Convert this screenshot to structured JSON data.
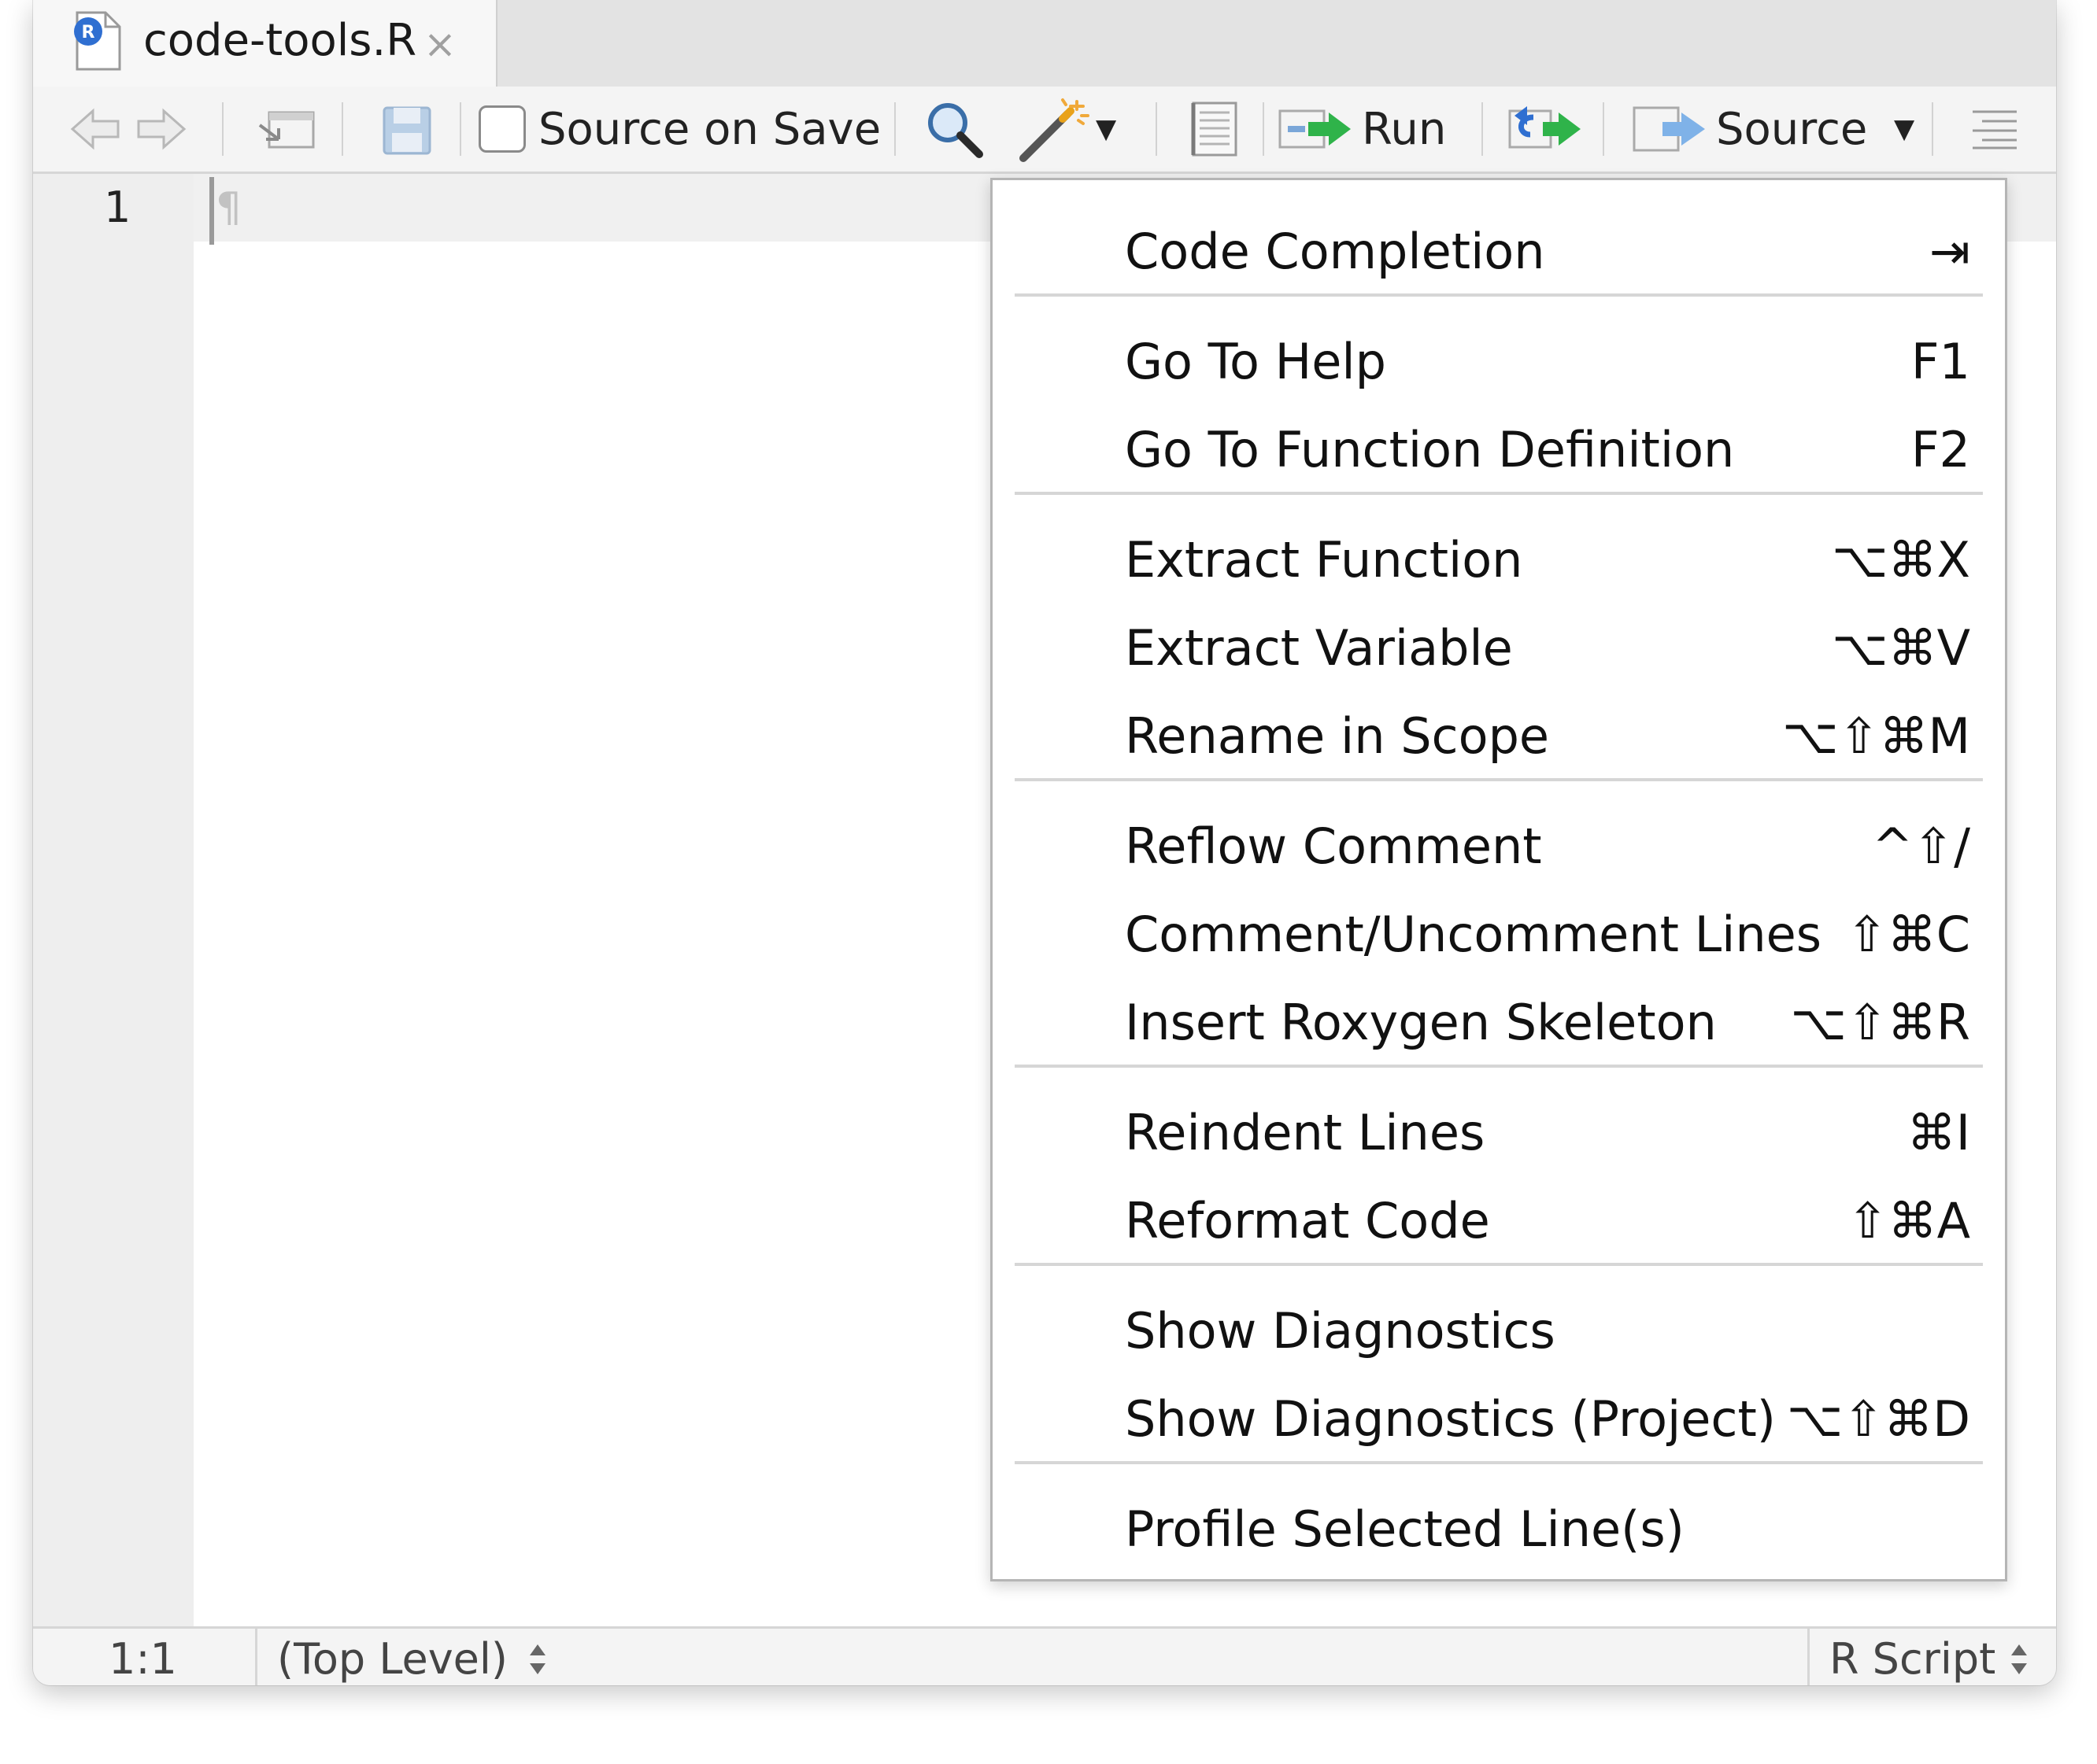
{
  "tab": {
    "title": "code-tools.R",
    "close": "×",
    "file_type_badge": "R"
  },
  "toolbar": {
    "source_on_save": "Source on Save",
    "run": "Run",
    "source": "Source"
  },
  "editor": {
    "line_number": "1",
    "pilcrow": "¶"
  },
  "statusbar": {
    "position": "1:1",
    "scope": "(Top Level)",
    "file_type": "R Script"
  },
  "menu": {
    "items": [
      {
        "label": "Code Completion",
        "shortcut": "⇥"
      },
      {
        "label": "Go To Help",
        "shortcut": "F1"
      },
      {
        "label": "Go To Function Definition",
        "shortcut": "F2"
      },
      {
        "label": "Extract Function",
        "shortcut": "⌥⌘X"
      },
      {
        "label": "Extract Variable",
        "shortcut": "⌥⌘V"
      },
      {
        "label": "Rename in Scope",
        "shortcut": "⌥⇧⌘M"
      },
      {
        "label": "Reflow Comment",
        "shortcut": "^⇧/"
      },
      {
        "label": "Comment/Uncomment Lines",
        "shortcut": "⇧⌘C"
      },
      {
        "label": "Insert Roxygen Skeleton",
        "shortcut": "⌥⇧⌘R"
      },
      {
        "label": "Reindent Lines",
        "shortcut": "⌘I"
      },
      {
        "label": "Reformat Code",
        "shortcut": "⇧⌘A"
      },
      {
        "label": "Show Diagnostics",
        "shortcut": ""
      },
      {
        "label": "Show Diagnostics (Project)",
        "shortcut": "⌥⇧⌘D"
      },
      {
        "label": "Profile Selected Line(s)",
        "shortcut": ""
      }
    ]
  },
  "colors": {
    "accent_blue": "#2f6fd1",
    "run_green": "#2fb34a",
    "menu_border": "#b5b5b5"
  }
}
